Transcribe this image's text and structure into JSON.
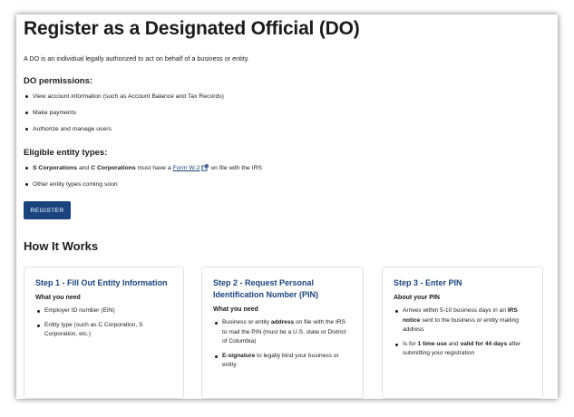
{
  "page": {
    "title": "Register as a Designated Official (DO)",
    "intro": "A DO is an individual legally authorized to act on behalf of a business or entity."
  },
  "permissions": {
    "title": "DO permissions:",
    "items": [
      "View account information (such as Account Balance and Tax Records)",
      "Make payments",
      "Authorize and manage users"
    ]
  },
  "eligible": {
    "title": "Eligible entity types:",
    "item1": {
      "bold1": "S Corporations",
      "and": " and ",
      "bold2": "C Corporations",
      "middle": " must have a ",
      "link": "Form W-2",
      "end": " on file with the IRS"
    },
    "item2": "Other entity types coming soon"
  },
  "register_button": "REGISTER",
  "how": {
    "title": "How It Works",
    "steps": [
      {
        "title": "Step 1 - Fill Out Entity Information",
        "subtitle": "What you need",
        "items": [
          "Employer ID number (EIN)",
          "Entity type (such as C Corporation, S Corporation, etc.)"
        ]
      },
      {
        "title": "Step 2 - Request Personal Identification Number (PIN)",
        "subtitle": "What you need",
        "item1": {
          "pre": "Business or entity ",
          "bold": "address",
          "post": " on file with the IRS to mail the PIN (must be a U.S. state or District of Columbia)"
        },
        "item2": {
          "bold": "E-signature",
          "post": " to legally bind your business or entity"
        }
      },
      {
        "title": "Step 3 - Enter PIN",
        "subtitle": "About your PIN",
        "item1": {
          "pre": "Arrives within 5-10 business days in an ",
          "bold": "IRS notice",
          "post": " sent to the business or entity mailing address"
        },
        "item2": {
          "pre": "Is for ",
          "bold1": "1 time use",
          "mid": " and ",
          "bold2": "valid for 44 days",
          "post": " after submitting your registration"
        }
      }
    ]
  },
  "icons": {
    "external_link": "external-link-icon"
  },
  "colors": {
    "primary": "#1a4480",
    "text": "#1b1b1b",
    "card_border": "#dfe1e2"
  }
}
